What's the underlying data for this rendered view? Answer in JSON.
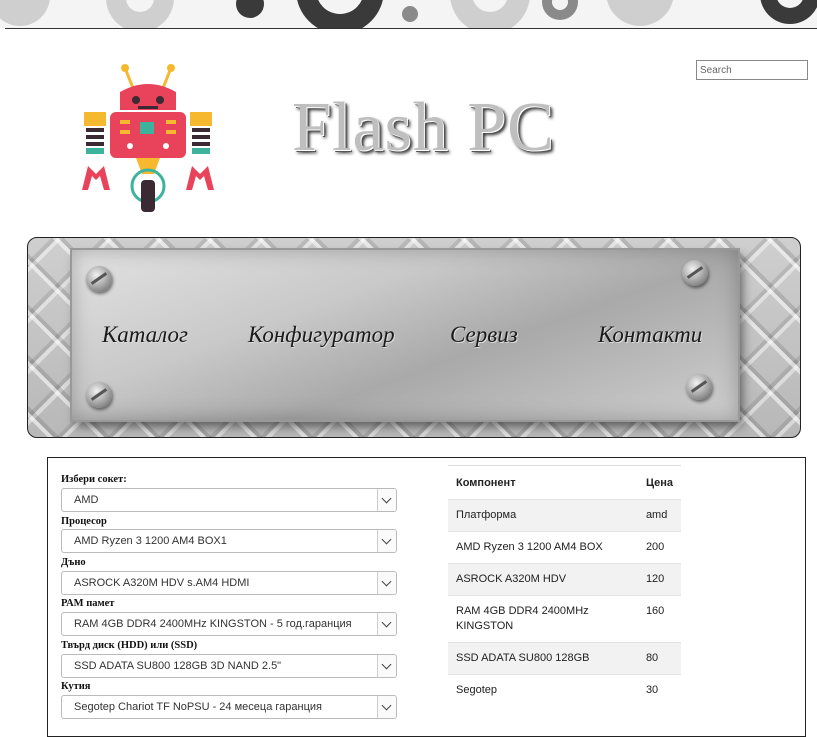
{
  "header": {
    "logo_text": "Flash PC",
    "search_placeholder": "Search"
  },
  "nav": {
    "items": [
      {
        "label": "Каталог"
      },
      {
        "label": "Конфигуратор"
      },
      {
        "label": "Сервиз"
      },
      {
        "label": "Контакти"
      }
    ]
  },
  "configurator": {
    "fields": [
      {
        "label": "Избери сокет:",
        "value": "AMD"
      },
      {
        "label": "Процесор",
        "value": "AMD Ryzen 3 1200 AM4 BOX1"
      },
      {
        "label": "Дъно",
        "value": "ASROCK A320M HDV s.AM4 HDMI"
      },
      {
        "label": "РАМ памет",
        "value": "RAM 4GB DDR4 2400MHz KINGSTON - 5 год.гаранция"
      },
      {
        "label": "Твърд диск (HDD) или (SSD)",
        "value": "SSD ADATA SU800 128GB 3D NAND 2.5\""
      },
      {
        "label": "Кутия",
        "value": "Segotep Chariot TF NoPSU - 24 месеца гаранция"
      }
    ]
  },
  "summary": {
    "headers": {
      "component": "Компонент",
      "price": "Цена"
    },
    "rows": [
      {
        "component": "Платформа",
        "price": "amd"
      },
      {
        "component": "AMD Ryzen 3 1200 AM4 BOX",
        "price": "200"
      },
      {
        "component": "ASROCK A320M HDV",
        "price": "120"
      },
      {
        "component": "RAM 4GB DDR4 2400MHz KINGSTON",
        "price": "160"
      },
      {
        "component": "SSD ADATA SU800 128GB",
        "price": "80"
      },
      {
        "component": "Segotep",
        "price": "30"
      }
    ]
  },
  "colors": {
    "robot_body": "#e8435a",
    "robot_accent": "#f5b82e",
    "robot_green": "#3db39e"
  }
}
